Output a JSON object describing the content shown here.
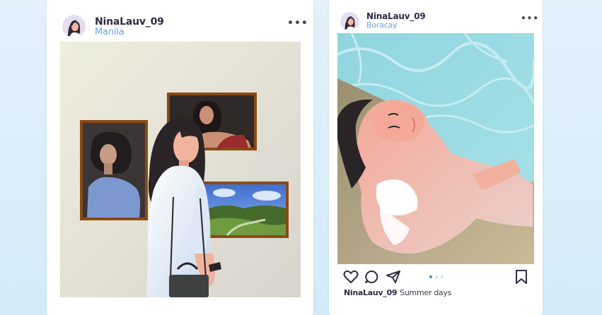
{
  "posts": [
    {
      "username": "NinaLauv_09",
      "location": "Manila",
      "more_glyph": "•••",
      "avatar_icon": "avatar",
      "photo": "museum-portrait-photo"
    },
    {
      "username": "NinaLauv_09",
      "location": "Boracay",
      "more_glyph": "•••",
      "avatar_icon": "avatar",
      "photo": "beach-sunbathing-photo",
      "caption_user": "NinaLauv_09",
      "caption_text": "Summer days",
      "carousel_count": 3,
      "carousel_active": 1
    }
  ],
  "icons": [
    "heart-icon",
    "comment-icon",
    "share-icon",
    "bookmark-icon"
  ],
  "colors": {
    "background": "#dcedf8",
    "username": "#2e2b43",
    "location": "#6fa3e8",
    "carousel_active": "#3a8fd8"
  }
}
